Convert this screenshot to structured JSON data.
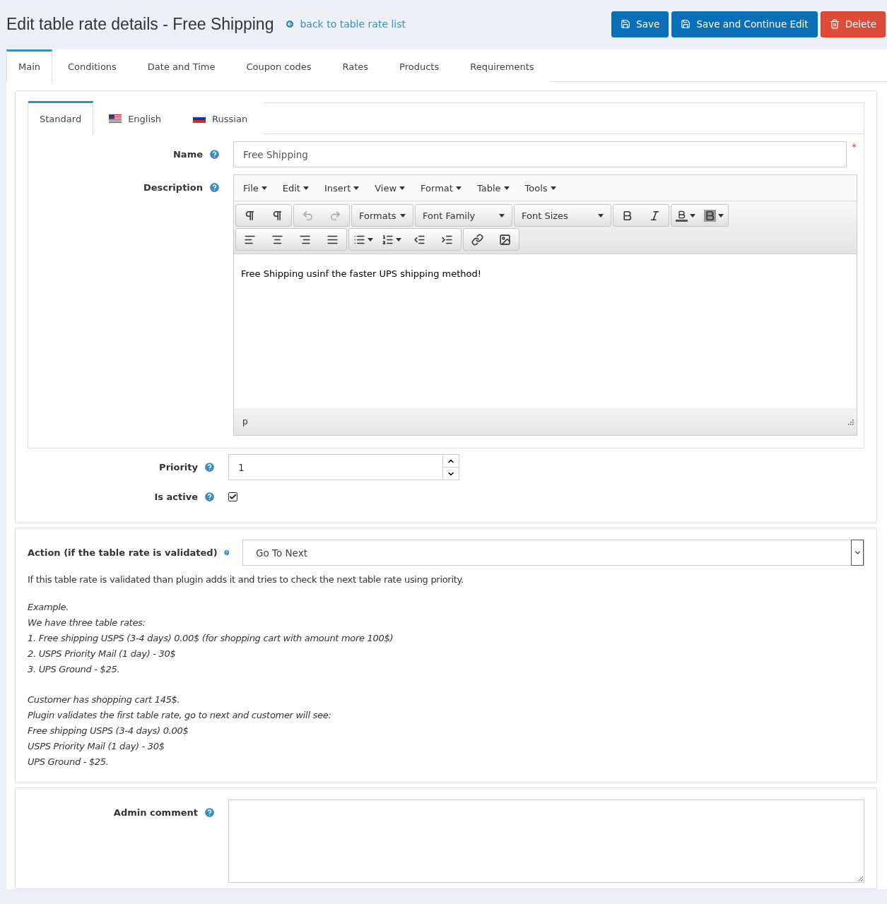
{
  "header": {
    "title": "Edit table rate details - Free Shipping",
    "back_link": "back to table rate list",
    "buttons": [
      {
        "kind": "save",
        "label": "Save"
      },
      {
        "kind": "save",
        "label": "Save and Continue Edit"
      },
      {
        "kind": "delete",
        "label": "Delete"
      }
    ]
  },
  "tabs": [
    {
      "label": "Main",
      "selected": true
    },
    {
      "label": "Conditions",
      "selected": false
    },
    {
      "label": "Date and Time",
      "selected": false
    },
    {
      "label": "Coupon codes",
      "selected": false
    },
    {
      "label": "Rates",
      "selected": false
    },
    {
      "label": "Products",
      "selected": false
    },
    {
      "label": "Requirements",
      "selected": false
    }
  ],
  "language_tabs": [
    {
      "label": "Standard",
      "kind": "plain",
      "selected": true
    },
    {
      "label": "English",
      "kind": "us_flag",
      "selected": false
    },
    {
      "label": "Russian",
      "kind": "ru_flag",
      "selected": false
    }
  ],
  "name_field": {
    "label": "Name",
    "value": "Free Shipping",
    "required_mark": "*"
  },
  "description": {
    "label": "Description",
    "menu": [
      "File",
      "Edit",
      "Insert",
      "View",
      "Format",
      "Table",
      "Tools"
    ],
    "dropdowns": [
      "Formats",
      "Font Family",
      "Font Sizes"
    ],
    "content": "Free Shipping usinf the faster UPS shipping method!",
    "status_path": "p"
  },
  "priority": {
    "label": "Priority",
    "value": "1"
  },
  "is_active": {
    "label": "Is active",
    "checked": true
  },
  "action": {
    "label": "Action (if the table rate is validated)",
    "value": "Go To Next"
  },
  "help": {
    "intro": "If this table rate is validated than plugin adds it and tries to check the next table rate using priority.",
    "example_groups": [
      [
        "Example.",
        "We have three table rates:",
        "1. Free shipping USPS (3-4 days) 0.00$ (for shopping cart with amount more 100$)",
        "2. USPS Priority Mail (1 day) - 30$",
        "3. UPS Ground - $25."
      ],
      [
        "Customer has shopping cart 145$.",
        "Plugin validates the first table rate, go to next and customer will see:",
        "Free shipping USPS (3-4 days) 0.00$",
        "USPS Priority Mail (1 day) - 30$",
        "UPS Ground - $25."
      ]
    ]
  },
  "admin_comment": {
    "label": "Admin comment"
  }
}
